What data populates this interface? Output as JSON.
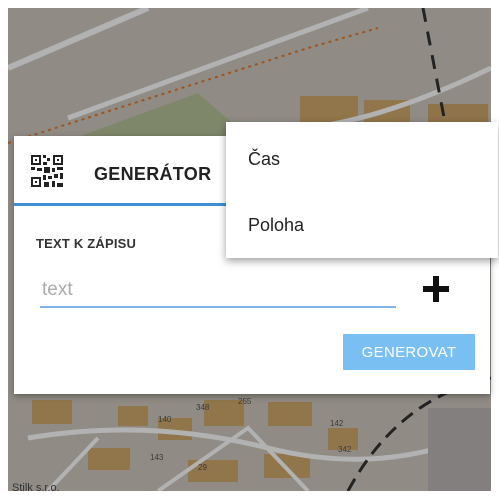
{
  "dialog": {
    "title": "GENERÁTOR",
    "section_label": "TEXT K ZÁPISU",
    "input": {
      "placeholder": "text",
      "value": ""
    },
    "generate_label": "GENEROVAT"
  },
  "menu": {
    "items": [
      {
        "label": "Čas"
      },
      {
        "label": "Poloha"
      }
    ]
  },
  "map": {
    "copyright": "Stilk s.r.o.",
    "labels": [
      "348",
      "255",
      "140",
      "142",
      "143",
      "29",
      "342"
    ]
  },
  "icons": {
    "qr": "qr-code-icon",
    "plus": "plus-icon"
  },
  "colors": {
    "accent": "#3f8fd6",
    "button": "#79bff2"
  }
}
